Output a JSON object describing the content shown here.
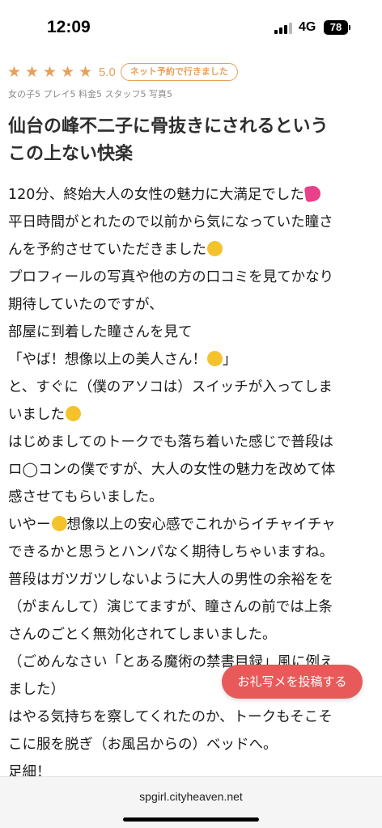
{
  "status_bar": {
    "time": "12:09",
    "network": "4G",
    "battery": "78"
  },
  "rating": {
    "stars": 5,
    "score": "5.0",
    "badge": "ネット予約で行きました",
    "star_color": "#e8a058"
  },
  "sub_scores": "女の子5 プレイ5 料金5 スタッフ5 写真5",
  "title": {
    "line1": "仙台の峰不二子に骨抜きにされるという",
    "line2": "この上ない快楽"
  },
  "review": {
    "lines": [
      "120分、終始大人の女性の魅力に大満足でした",
      "平日時間がとれたので以前から気になっていた瞳さ",
      "んを予約させていただきました",
      "プロフィールの写真や他の方の口コミを見てかなり",
      "期待していたのですが、",
      "部屋に到着した瞳さんを見て",
      "「やば！想像以上の美人さん！",
      "」",
      "と、すぐに（僕のアソコは）スイッチが入ってしま",
      "いました",
      "はじめましてのトークでも落ち着いた感じで普段は",
      "ロ◯コンの僕ですが、大人の女性の魅力を改めて体",
      "感させてもらいました。",
      "いやー",
      "想像以上の安心感でこれからイチャイチャ",
      "できるかと思うとハンパなく期待しちゃいますね。",
      "普段はガツガツしないように大人の男性の余裕をを",
      "（がまんして）演じてますが、瞳さんの前では上条",
      "さんのごとく無効化されてしまいました。",
      "（ごめんなさい「とある魔術の禁書目録」風に例え",
      "ました）",
      "はやる気持ちを察してくれたのか、トークもそこそ",
      "こに服を脱ぎ（お風呂からの）ベッドへ。",
      "足細！"
    ]
  },
  "post_button": {
    "label": "お礼写メを投稿する",
    "color": "#e85a5a"
  },
  "browser": {
    "url": "spgirl.cityheaven.net"
  }
}
